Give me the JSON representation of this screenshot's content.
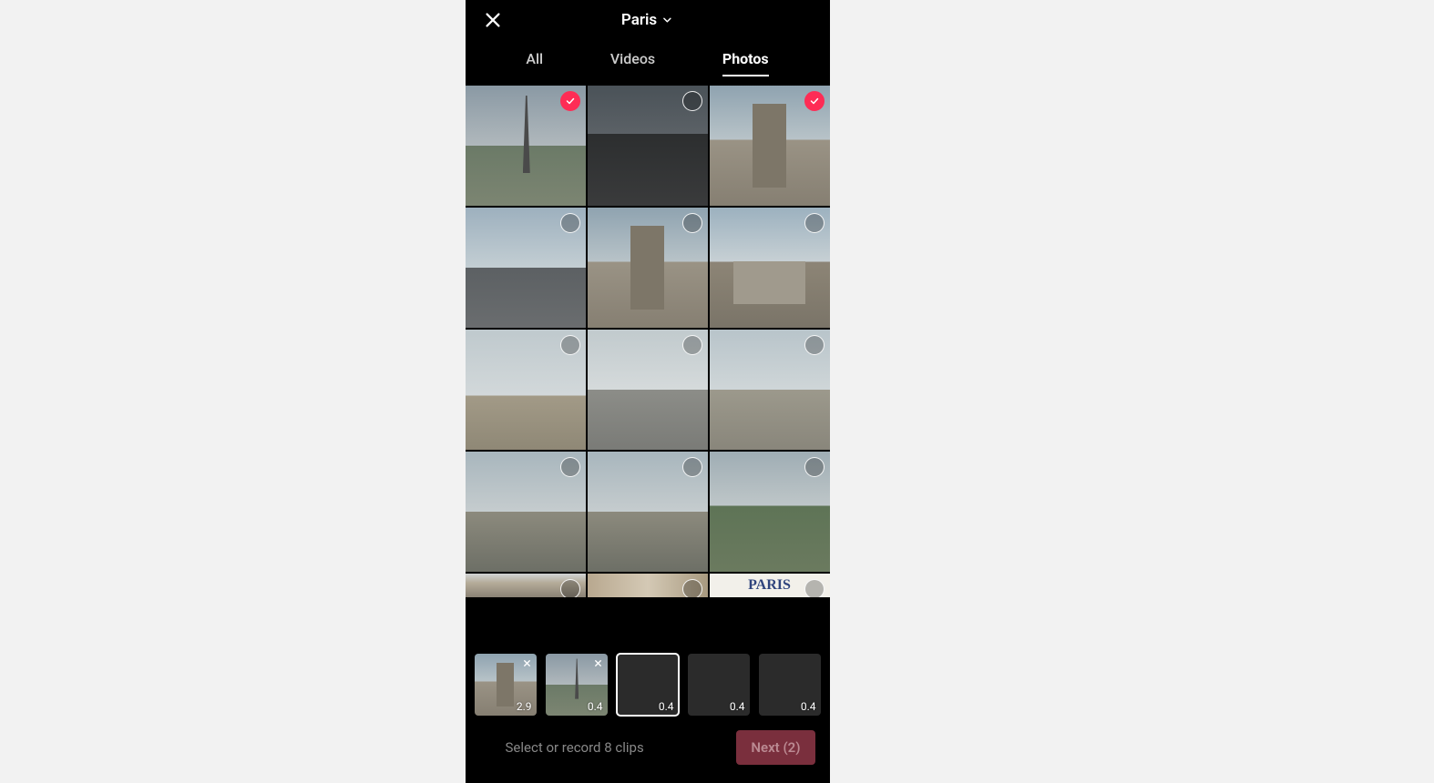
{
  "header": {
    "title": "Paris"
  },
  "tabs": {
    "all": "All",
    "videos": "Videos",
    "photos": "Photos",
    "active": "photos"
  },
  "grid": {
    "photos": [
      {
        "style": "eiffel",
        "selected": true
      },
      {
        "style": "street",
        "selected": false
      },
      {
        "style": "monument",
        "selected": true
      },
      {
        "style": "plaza",
        "selected": false
      },
      {
        "style": "monument",
        "selected": false
      },
      {
        "style": "temple",
        "selected": false
      },
      {
        "style": "bridge",
        "selected": false
      },
      {
        "style": "road",
        "selected": false
      },
      {
        "style": "bldg",
        "selected": false
      },
      {
        "style": "riverside",
        "selected": false
      },
      {
        "style": "riverside",
        "selected": false
      },
      {
        "style": "trees",
        "selected": false
      }
    ],
    "partial": [
      {
        "style": "arch"
      },
      {
        "style": "mixed"
      },
      {
        "style": "postcard",
        "text": "PARIS"
      }
    ]
  },
  "tray": {
    "slots": [
      {
        "duration": "2.9",
        "filled": true,
        "style": "monument",
        "current": false
      },
      {
        "duration": "0.4",
        "filled": true,
        "style": "eiffel",
        "current": false
      },
      {
        "duration": "0.4",
        "filled": false,
        "current": true
      },
      {
        "duration": "0.4",
        "filled": false,
        "current": false
      },
      {
        "duration": "0.4",
        "filled": false,
        "current": false
      }
    ]
  },
  "bottom": {
    "hint": "Select or record 8 clips",
    "next_label": "Next (2)"
  }
}
